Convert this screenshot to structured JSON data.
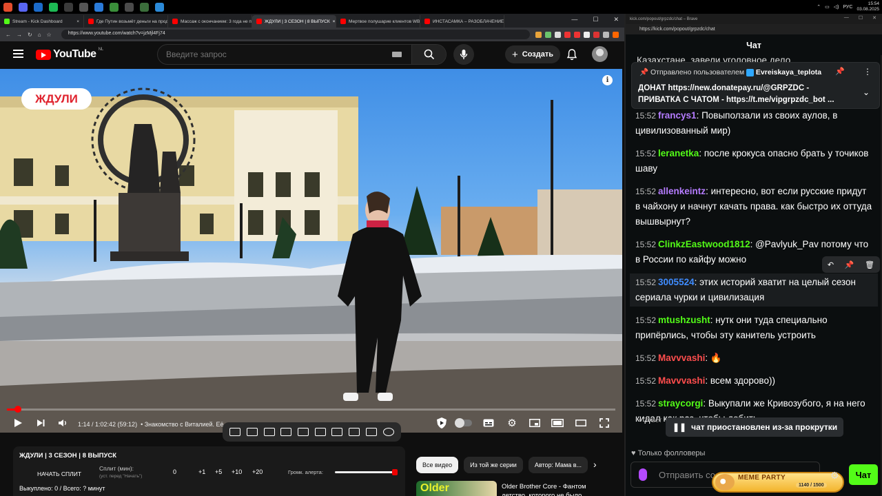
{
  "taskbar": {
    "clock_time": "15:54",
    "clock_date": "03.08.2025",
    "lang": "РУС",
    "app_colors": [
      "#e24c2c",
      "#5865f2",
      "#1b6ac9",
      "#1db954",
      "#3a3a3a",
      "#555555",
      "#2a7ad8",
      "#3a8f3a",
      "#4a4a4a",
      "#3b6e3b",
      "#2b8ad8"
    ]
  },
  "browser": {
    "tabs": [
      {
        "label": "Stream - Kick Dashboard",
        "color": "#53fc18"
      },
      {
        "label": "Где Путин возьмёт деньги на прод...",
        "color": "#ff0000"
      },
      {
        "label": "Массаж с окончанием: 3 года не п...",
        "color": "#ff0000"
      },
      {
        "label": "ЖДУЛИ | 3 СЕЗОН | 8 ВЫПУСК",
        "color": "#ff0000"
      },
      {
        "label": "Мертвое полушарие клиентов WB...",
        "color": "#ff0000"
      },
      {
        "label": "ИНСТАСАМКА – РАЗОБЛАЧЕНИЕ д...",
        "color": "#ff0000"
      }
    ],
    "url": "https://www.youtube.com/watch?v=jzMjl4Fj74"
  },
  "youtube": {
    "logo_text": "YouTube",
    "region": "NL",
    "search_placeholder": "Введите запрос",
    "create_label": "Создать",
    "video": {
      "badge": "ЖДУЛИ",
      "progress_fraction": 0.0186,
      "time": "1:14 / 1:02:42 (59:12)",
      "chapter": "• Знакомство с Виталией. Её семья",
      "chevron": "›"
    }
  },
  "stream_panel": {
    "title": "ЖДУЛИ | 3 СЕЗОН | 8 ВЫПУСК",
    "split_button": "НАЧАТЬ СПЛИТ",
    "split_label": "Сплит (мин):",
    "split_hint": "(уст. перед \"Начать\")",
    "split_value": "0",
    "increments": [
      "+1",
      "+5",
      "+10",
      "+20"
    ],
    "alert_label": "Громк. алерта:",
    "alert_volume": 1.0,
    "bought": "Выкуплено: 0 / Всего: ? минут"
  },
  "chips": [
    "Все видео",
    "Из той же серии",
    "Автор: Мама в..."
  ],
  "rec": {
    "thumb_text": "Older",
    "title": "Older Brother Core - Фантом детство, которого не было"
  },
  "chat_window": {
    "title": "kick.com/popout/grpzdc/chat – Brave",
    "url": "https://kick.com/popout/grpzdc/chat",
    "header": "Чат",
    "cut_top": "Казахстане, завели уголовное дело",
    "pinned": {
      "sent_by_label": "Отправлено пользователем",
      "sent_by_user": "Evreiskaya_teplota",
      "line1": "ДОНАТ https://new.donatepay.ru/@GRPZDC -",
      "line2": "ПРИВАТКА С ЧАТОМ - https://t.me/vipgrpzdc_bot ..."
    },
    "messages": [
      {
        "time": "15:52",
        "user": "francys1",
        "color": "#b57cff",
        "text": ": Повыползали из своих аулов, в цивилизованный мир)"
      },
      {
        "time": "15:52",
        "user": "leranetka",
        "color": "#53fc18",
        "text": ": после крокуса опасно брать у точиков шаву"
      },
      {
        "time": "15:52",
        "user": "allenkeintz",
        "color": "#b57cff",
        "text": ": интересно, вот если русские придут в чайхону и начнут качать права. как быстро их оттуда вышвырнут?"
      },
      {
        "time": "15:52",
        "user": "ClinkzEastwood1812",
        "color": "#53fc18",
        "text": ": @Pavlyuk_Pav потому что в России по кайфу можно"
      },
      {
        "time": "15:52",
        "user": "3005524",
        "color": "#3f8cff",
        "text": ": этих историй хватит на целый сезон сериала чурки и цивилизация"
      },
      {
        "time": "15:52",
        "user": "mtushzusht",
        "color": "#53fc18",
        "text": ": нутк они туда специально припёрлись, чтобы эту канитель устроить"
      },
      {
        "time": "15:52",
        "user": "Mavvvashi",
        "color": "#ff4d4d",
        "text": ": 🔥"
      },
      {
        "time": "15:52",
        "user": "Mavvvashi",
        "color": "#ff4d4d",
        "text": ": всем здорово))"
      },
      {
        "time": "15:52",
        "user": "straycorgi",
        "color": "#53fc18",
        "text": ": Выкупали же Кривозубого, я на него кидал как раз, чтобы добить"
      }
    ],
    "reply_hint": "↪ Ответ",
    "paused": "чат приостановлен из-за прокрутки",
    "followers_only": "Только фолловеры",
    "input_placeholder": "Отправить со...",
    "meme_title": "MEME PARTY",
    "meme_count": "1140 / 1500",
    "send": "Чат"
  }
}
